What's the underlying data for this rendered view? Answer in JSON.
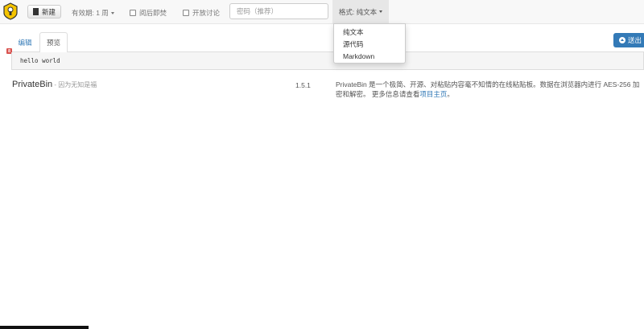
{
  "navbar": {
    "new_label": "新建",
    "expiry_label": "有效期: 1 周",
    "burn_label": "阅后即焚",
    "discussion_label": "开放讨论",
    "password_placeholder": "密码（推荐）",
    "format_label": "格式: 纯文本"
  },
  "format_menu": {
    "items": [
      "纯文本",
      "源代码",
      "Markdown"
    ]
  },
  "send_label": "送出",
  "tabs": {
    "edit": "编辑",
    "preview": "预览"
  },
  "editor": {
    "content": "hello world",
    "marker": "8"
  },
  "footer": {
    "brand": "PrivateBin",
    "tagline": " - 因为无知是福",
    "version": "1.5.1",
    "description": "PrivateBin 是一个极简、开源、对粘贴内容毫不知情的在线粘贴板。数据在浏览器内进行 AES-256 加密和解密。 更多信息请查看",
    "project_link": "项目主页",
    "description_end": "。"
  },
  "colors": {
    "primary": "#337ab7",
    "navbar_bg": "#f8f8f8",
    "marker": "#d9534f"
  }
}
